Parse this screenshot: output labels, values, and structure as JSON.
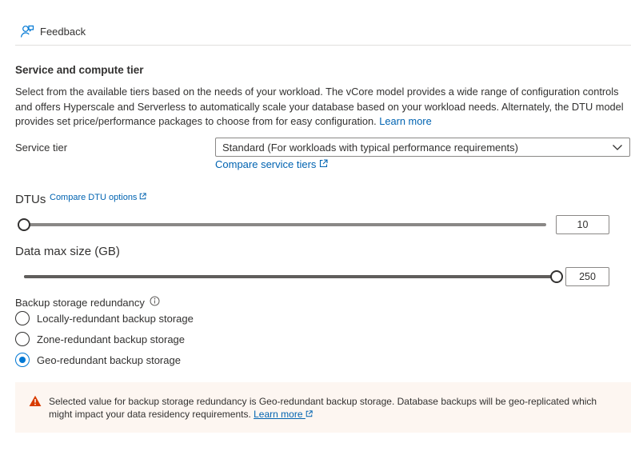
{
  "toolbar": {
    "feedback_label": "Feedback"
  },
  "section": {
    "title": "Service and compute tier",
    "description": "Select from the available tiers based on the needs of your workload. The vCore model provides a wide range of configuration controls and offers Hyperscale and Serverless to automatically scale your database based on your workload needs. Alternately, the DTU model provides set price/performance packages to choose from for easy configuration.",
    "learn_more": "Learn more"
  },
  "service_tier": {
    "label": "Service tier",
    "selected": "Standard (For workloads with typical performance requirements)",
    "compare_link": "Compare service tiers"
  },
  "dtus": {
    "label": "DTUs",
    "compare_link": "Compare DTU options",
    "value": "10",
    "slider_fraction": 0.0
  },
  "data_max": {
    "label": "Data max size (GB)",
    "value": "250",
    "slider_fraction": 1.0
  },
  "backup": {
    "label": "Backup storage redundancy",
    "options": [
      {
        "label": "Locally-redundant backup storage",
        "checked": false
      },
      {
        "label": "Zone-redundant backup storage",
        "checked": false
      },
      {
        "label": "Geo-redundant backup storage",
        "checked": true
      }
    ]
  },
  "warning": {
    "text": "Selected value for backup storage redundancy is Geo-redundant backup storage. Database backups will be geo-replicated which might impact your data residency requirements.",
    "learn_more": "Learn more"
  },
  "colors": {
    "link": "#0063b1",
    "accent": "#0078d4",
    "warning_icon": "#d83b01",
    "warning_bg": "#fdf6f1"
  },
  "icons": {
    "feedback": "feedback-person-icon",
    "dropdown": "chevron-down-icon",
    "external": "external-link-icon",
    "info": "info-icon",
    "warning": "warning-icon"
  }
}
